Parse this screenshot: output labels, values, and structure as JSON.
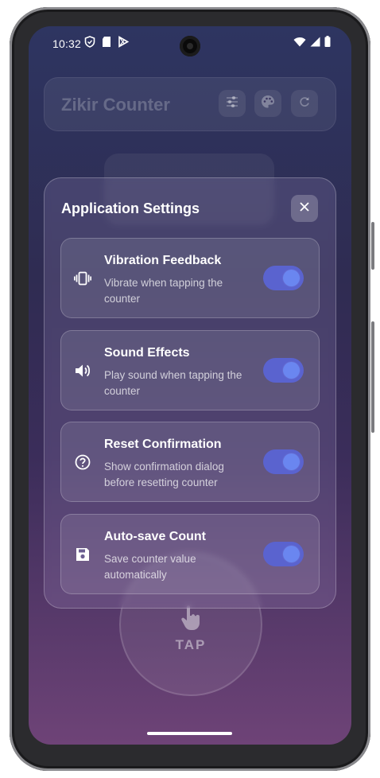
{
  "status_bar": {
    "time": "10:32",
    "left_icons": [
      "shield-icon",
      "sd-card-icon",
      "play-store-icon"
    ],
    "right_icons": [
      "wifi-icon",
      "signal-icon",
      "battery-icon"
    ]
  },
  "app_bar": {
    "title": "Zikir Counter",
    "buttons": [
      "tune-icon",
      "palette-icon",
      "refresh-icon"
    ]
  },
  "tap_button": {
    "label": "TAP"
  },
  "dialog": {
    "title": "Application Settings",
    "options": [
      {
        "title": "Vibration Feedback",
        "description": "Vibrate when tapping the counter",
        "icon": "vibration-icon",
        "enabled": true
      },
      {
        "title": "Sound Effects",
        "description": "Play sound when tapping the counter",
        "icon": "volume-icon",
        "enabled": true
      },
      {
        "title": "Reset Confirmation",
        "description": "Show confirmation dialog before resetting counter",
        "icon": "help-circle-icon",
        "enabled": true
      },
      {
        "title": "Auto-save Count",
        "description": "Save counter value automatically",
        "icon": "save-icon",
        "enabled": true
      }
    ]
  },
  "colors": {
    "toggle_track": "#5a63cf",
    "toggle_thumb": "#6a86f0",
    "background_top": "#2e3561",
    "background_bottom": "#6e4377"
  }
}
